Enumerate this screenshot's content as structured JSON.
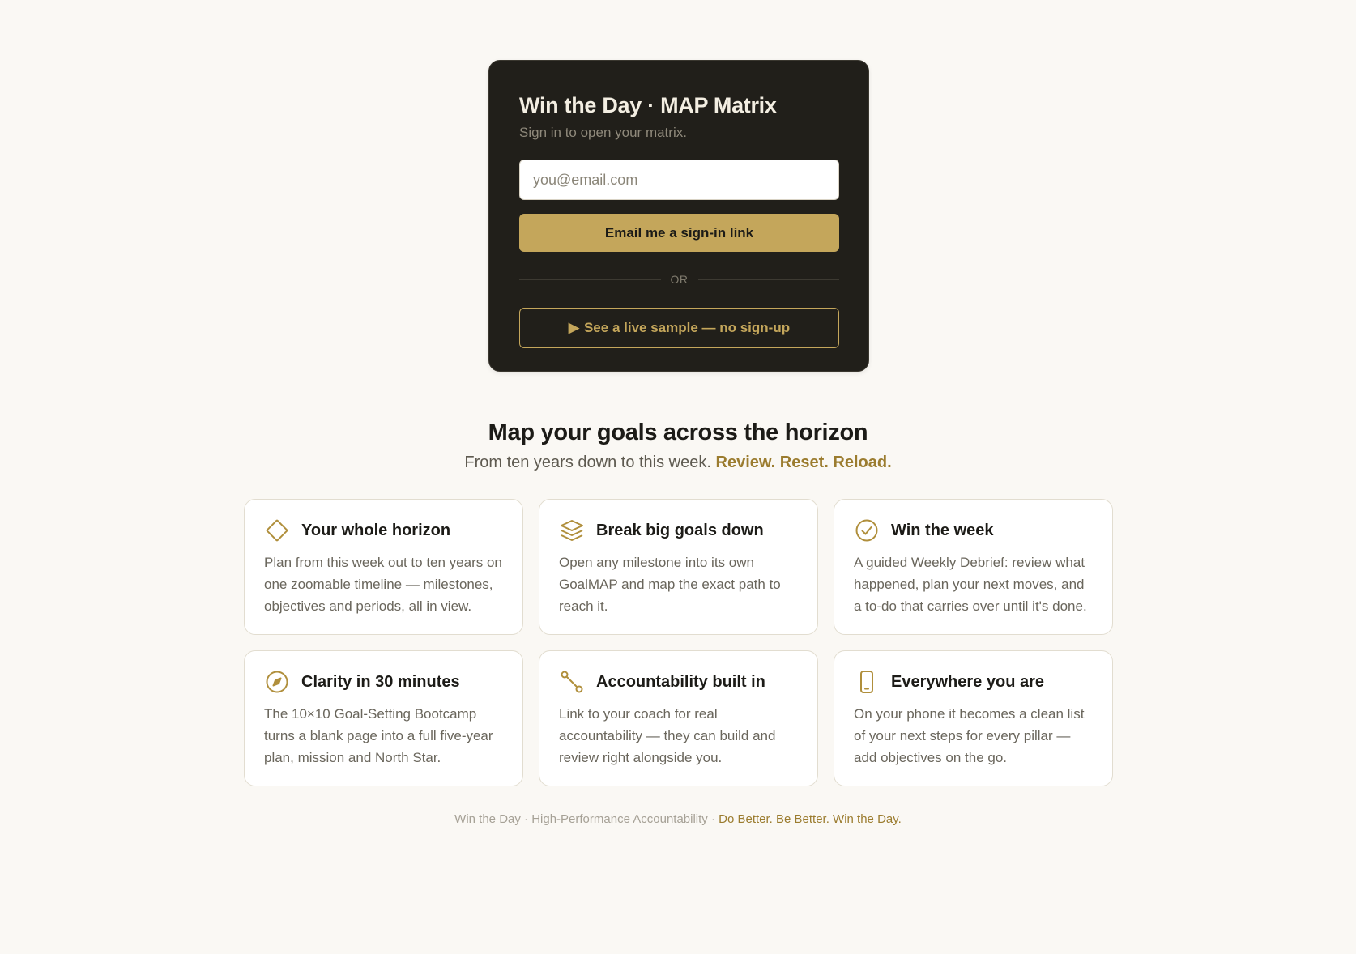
{
  "signin": {
    "title": "Win the Day · MAP Matrix",
    "subtitle": "Sign in to open your matrix.",
    "email_placeholder": "you@email.com",
    "email_value": "",
    "primary_label": "Email me a sign-in link",
    "divider_label": "OR",
    "sample_icon": "▶",
    "sample_label": "See a live sample — no sign-up"
  },
  "hero": {
    "headline": "Map your goals across the horizon",
    "sub_text": "From ten years down to this week.",
    "sub_accent": "Review. Reset. Reload."
  },
  "features": [
    {
      "icon": "diamond-icon",
      "title": "Your whole horizon",
      "body": "Plan from this week out to ten years on one zoomable timeline — milestones, objectives and periods, all in view."
    },
    {
      "icon": "layers-icon",
      "title": "Break big goals down",
      "body": "Open any milestone into its own GoalMAP and map the exact path to reach it."
    },
    {
      "icon": "check-circle-icon",
      "title": "Win the week",
      "body": "A guided Weekly Debrief: review what happened, plan your next moves, and a to-do that carries over until it's done."
    },
    {
      "icon": "compass-icon",
      "title": "Clarity in 30 minutes",
      "body": "The 10×10 Goal-Setting Bootcamp turns a blank page into a full five-year plan, mission and North Star."
    },
    {
      "icon": "link-icon",
      "title": "Accountability built in",
      "body": "Link to your coach for real accountability — they can build and review right alongside you."
    },
    {
      "icon": "phone-icon",
      "title": "Everywhere you are",
      "body": "On your phone it becomes a clean list of your next steps for every pillar — add objectives on the go."
    }
  ],
  "footer": {
    "text": "Win the Day · High-Performance Accountability ·",
    "accent": "Do Better. Be Better. Win the Day."
  },
  "colors": {
    "background": "#faf8f4",
    "card_dark": "#211f1a",
    "gold": "#c4a65b",
    "gold_text": "#9b7c2f"
  }
}
